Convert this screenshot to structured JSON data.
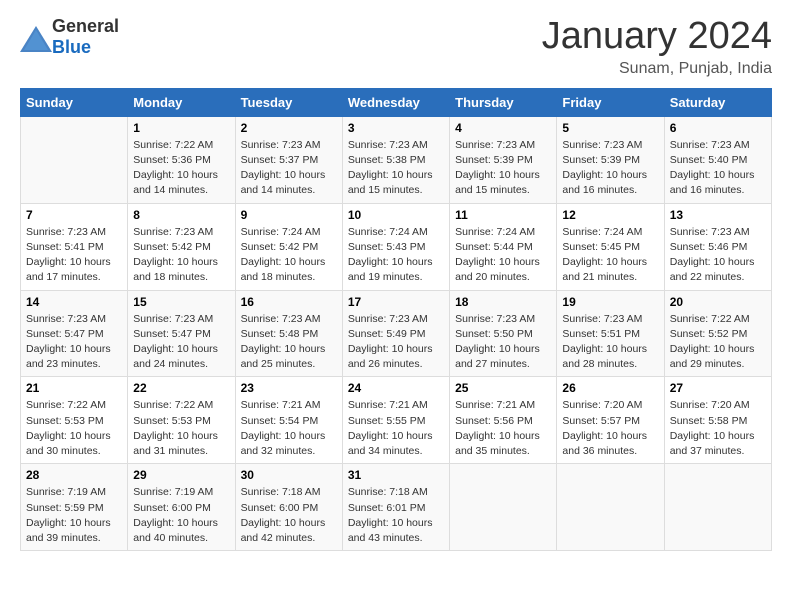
{
  "header": {
    "logo": {
      "general": "General",
      "blue": "Blue"
    },
    "title": "January 2024",
    "location": "Sunam, Punjab, India"
  },
  "weekdays": [
    "Sunday",
    "Monday",
    "Tuesday",
    "Wednesday",
    "Thursday",
    "Friday",
    "Saturday"
  ],
  "weeks": [
    [
      {
        "day": "",
        "info": ""
      },
      {
        "day": "1",
        "info": "Sunrise: 7:22 AM\nSunset: 5:36 PM\nDaylight: 10 hours\nand 14 minutes."
      },
      {
        "day": "2",
        "info": "Sunrise: 7:23 AM\nSunset: 5:37 PM\nDaylight: 10 hours\nand 14 minutes."
      },
      {
        "day": "3",
        "info": "Sunrise: 7:23 AM\nSunset: 5:38 PM\nDaylight: 10 hours\nand 15 minutes."
      },
      {
        "day": "4",
        "info": "Sunrise: 7:23 AM\nSunset: 5:39 PM\nDaylight: 10 hours\nand 15 minutes."
      },
      {
        "day": "5",
        "info": "Sunrise: 7:23 AM\nSunset: 5:39 PM\nDaylight: 10 hours\nand 16 minutes."
      },
      {
        "day": "6",
        "info": "Sunrise: 7:23 AM\nSunset: 5:40 PM\nDaylight: 10 hours\nand 16 minutes."
      }
    ],
    [
      {
        "day": "7",
        "info": "Sunrise: 7:23 AM\nSunset: 5:41 PM\nDaylight: 10 hours\nand 17 minutes."
      },
      {
        "day": "8",
        "info": "Sunrise: 7:23 AM\nSunset: 5:42 PM\nDaylight: 10 hours\nand 18 minutes."
      },
      {
        "day": "9",
        "info": "Sunrise: 7:24 AM\nSunset: 5:42 PM\nDaylight: 10 hours\nand 18 minutes."
      },
      {
        "day": "10",
        "info": "Sunrise: 7:24 AM\nSunset: 5:43 PM\nDaylight: 10 hours\nand 19 minutes."
      },
      {
        "day": "11",
        "info": "Sunrise: 7:24 AM\nSunset: 5:44 PM\nDaylight: 10 hours\nand 20 minutes."
      },
      {
        "day": "12",
        "info": "Sunrise: 7:24 AM\nSunset: 5:45 PM\nDaylight: 10 hours\nand 21 minutes."
      },
      {
        "day": "13",
        "info": "Sunrise: 7:23 AM\nSunset: 5:46 PM\nDaylight: 10 hours\nand 22 minutes."
      }
    ],
    [
      {
        "day": "14",
        "info": "Sunrise: 7:23 AM\nSunset: 5:47 PM\nDaylight: 10 hours\nand 23 minutes."
      },
      {
        "day": "15",
        "info": "Sunrise: 7:23 AM\nSunset: 5:47 PM\nDaylight: 10 hours\nand 24 minutes."
      },
      {
        "day": "16",
        "info": "Sunrise: 7:23 AM\nSunset: 5:48 PM\nDaylight: 10 hours\nand 25 minutes."
      },
      {
        "day": "17",
        "info": "Sunrise: 7:23 AM\nSunset: 5:49 PM\nDaylight: 10 hours\nand 26 minutes."
      },
      {
        "day": "18",
        "info": "Sunrise: 7:23 AM\nSunset: 5:50 PM\nDaylight: 10 hours\nand 27 minutes."
      },
      {
        "day": "19",
        "info": "Sunrise: 7:23 AM\nSunset: 5:51 PM\nDaylight: 10 hours\nand 28 minutes."
      },
      {
        "day": "20",
        "info": "Sunrise: 7:22 AM\nSunset: 5:52 PM\nDaylight: 10 hours\nand 29 minutes."
      }
    ],
    [
      {
        "day": "21",
        "info": "Sunrise: 7:22 AM\nSunset: 5:53 PM\nDaylight: 10 hours\nand 30 minutes."
      },
      {
        "day": "22",
        "info": "Sunrise: 7:22 AM\nSunset: 5:53 PM\nDaylight: 10 hours\nand 31 minutes."
      },
      {
        "day": "23",
        "info": "Sunrise: 7:21 AM\nSunset: 5:54 PM\nDaylight: 10 hours\nand 32 minutes."
      },
      {
        "day": "24",
        "info": "Sunrise: 7:21 AM\nSunset: 5:55 PM\nDaylight: 10 hours\nand 34 minutes."
      },
      {
        "day": "25",
        "info": "Sunrise: 7:21 AM\nSunset: 5:56 PM\nDaylight: 10 hours\nand 35 minutes."
      },
      {
        "day": "26",
        "info": "Sunrise: 7:20 AM\nSunset: 5:57 PM\nDaylight: 10 hours\nand 36 minutes."
      },
      {
        "day": "27",
        "info": "Sunrise: 7:20 AM\nSunset: 5:58 PM\nDaylight: 10 hours\nand 37 minutes."
      }
    ],
    [
      {
        "day": "28",
        "info": "Sunrise: 7:19 AM\nSunset: 5:59 PM\nDaylight: 10 hours\nand 39 minutes."
      },
      {
        "day": "29",
        "info": "Sunrise: 7:19 AM\nSunset: 6:00 PM\nDaylight: 10 hours\nand 40 minutes."
      },
      {
        "day": "30",
        "info": "Sunrise: 7:18 AM\nSunset: 6:00 PM\nDaylight: 10 hours\nand 42 minutes."
      },
      {
        "day": "31",
        "info": "Sunrise: 7:18 AM\nSunset: 6:01 PM\nDaylight: 10 hours\nand 43 minutes."
      },
      {
        "day": "",
        "info": ""
      },
      {
        "day": "",
        "info": ""
      },
      {
        "day": "",
        "info": ""
      }
    ]
  ]
}
